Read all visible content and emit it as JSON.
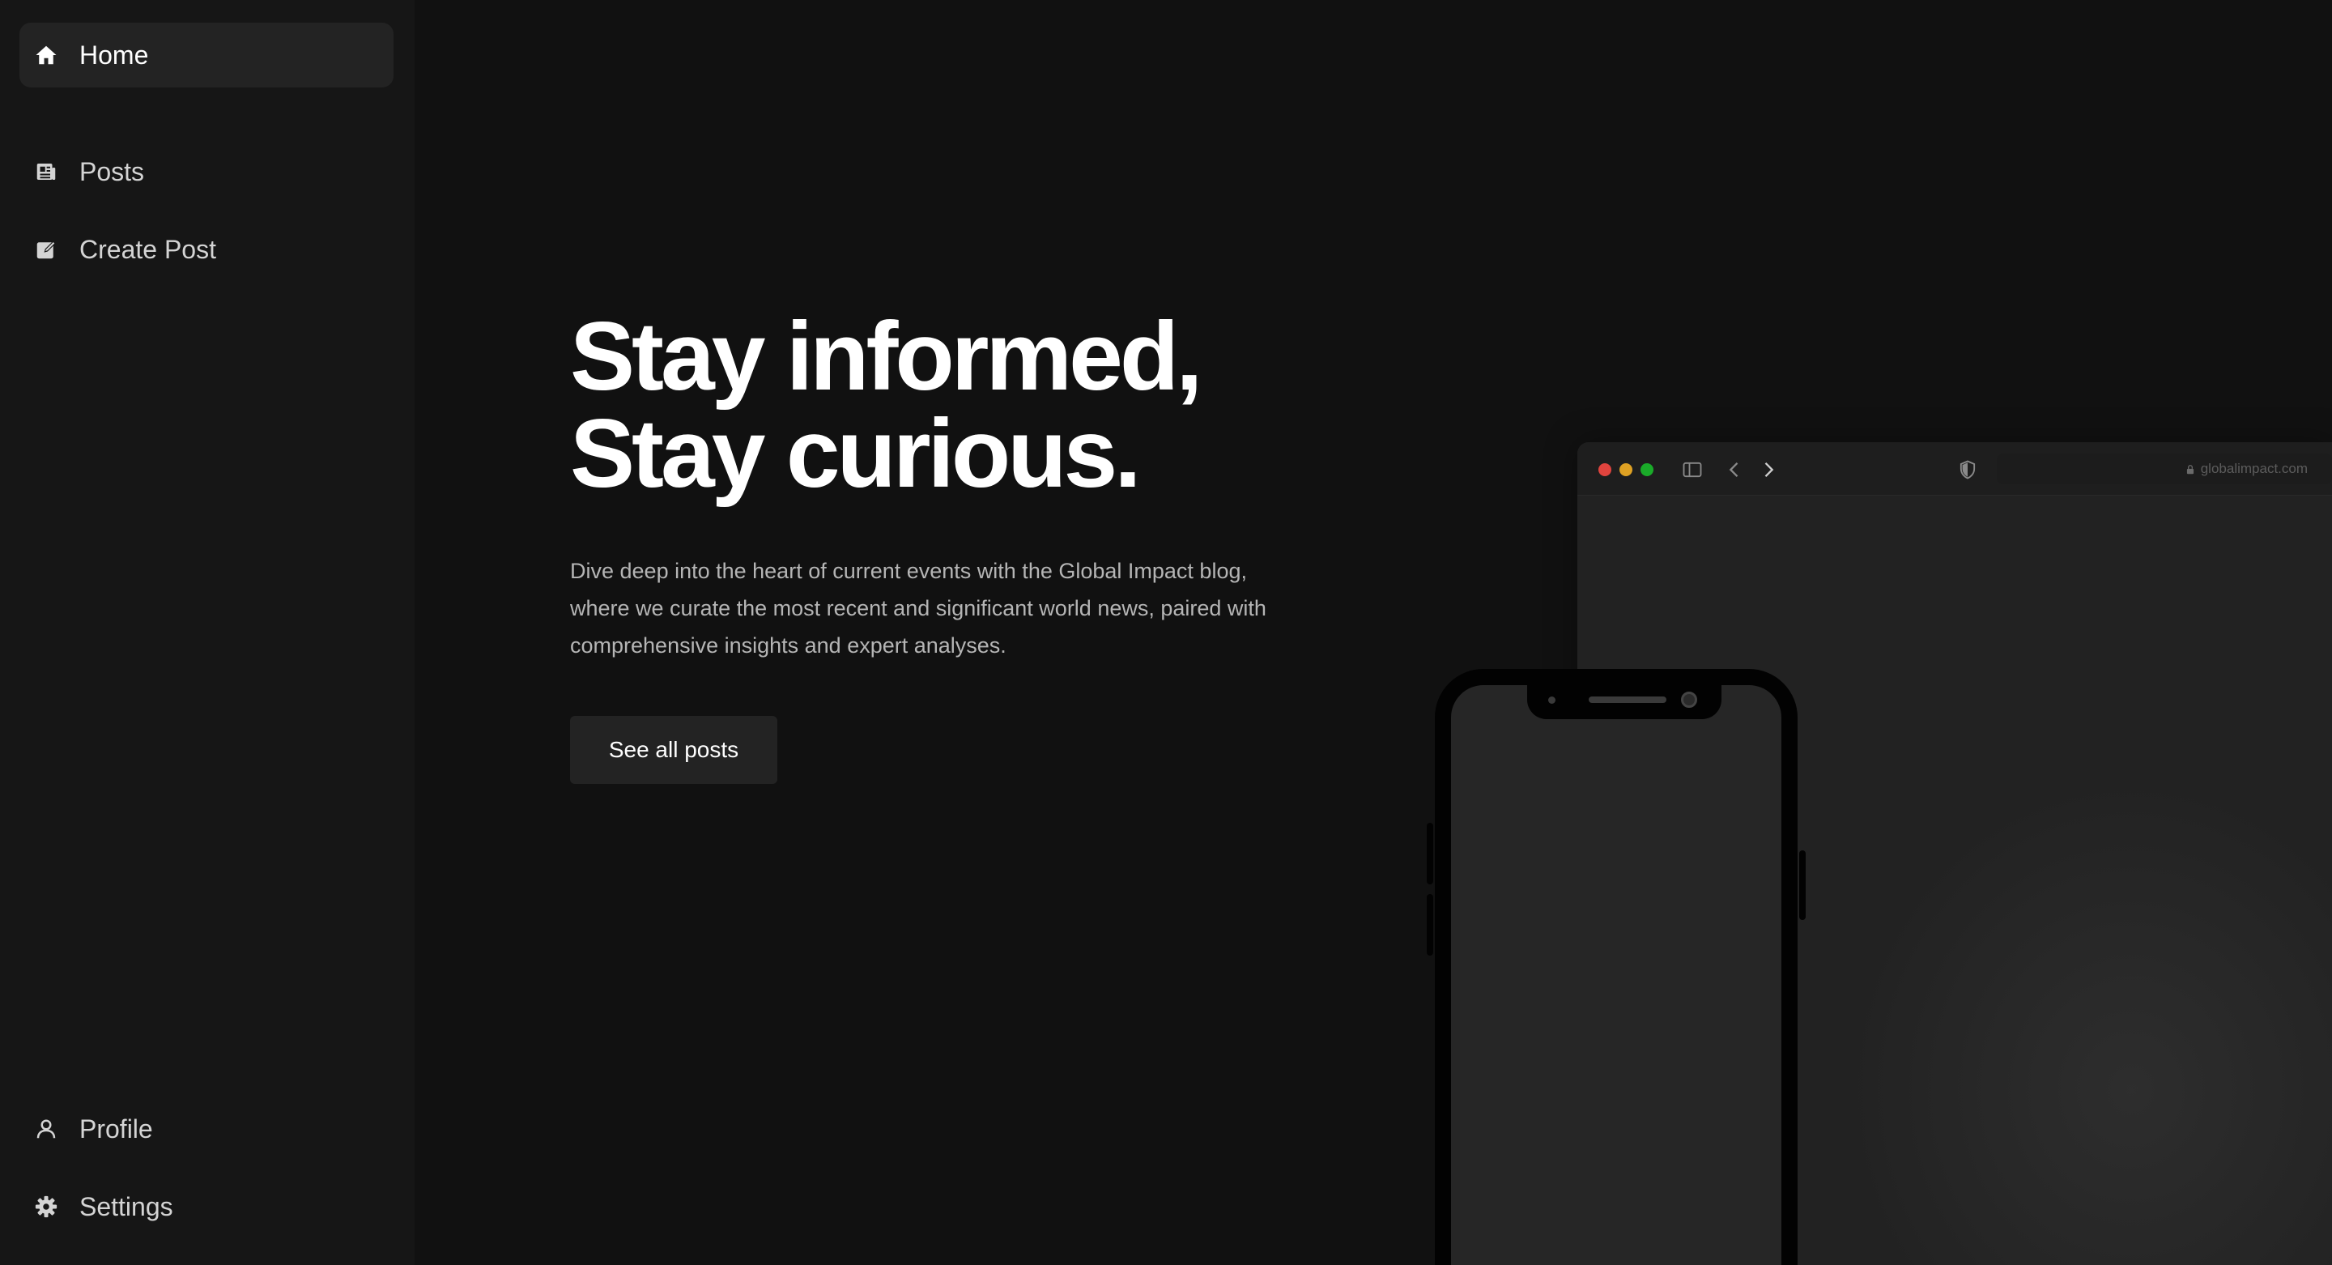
{
  "sidebar": {
    "items": [
      {
        "label": "Home",
        "icon": "home-icon",
        "active": true
      },
      {
        "label": "Posts",
        "icon": "newspaper-icon"
      },
      {
        "label": "Create Post",
        "icon": "edit-icon"
      },
      {
        "label": "Profile",
        "icon": "user-icon"
      },
      {
        "label": "Settings",
        "icon": "gear-icon"
      }
    ]
  },
  "hero": {
    "title_line1": "Stay informed,",
    "title_line2": "Stay curious.",
    "description": "Dive deep into the heart of current events with the Global Impact blog, where we curate the most recent and significant world news, paired with comprehensive insights and expert analyses.",
    "cta_label": "See all posts"
  },
  "browser_mockup": {
    "url": "globalimpact.com"
  },
  "colors": {
    "background": "#111111",
    "sidebar": "#161616",
    "active_item": "#232323",
    "button": "#232323"
  }
}
